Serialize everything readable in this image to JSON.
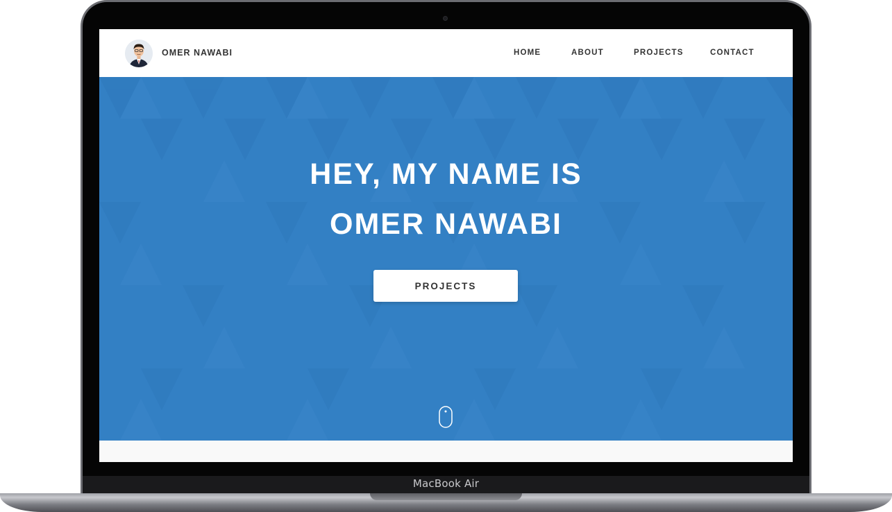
{
  "device": {
    "label": "MacBook Air"
  },
  "navbar": {
    "site_name": "OMER NAWABI",
    "avatar_icon": "avatar-portrait",
    "items": [
      {
        "label": "HOME"
      },
      {
        "label": "ABOUT"
      },
      {
        "label": "PROJECTS"
      },
      {
        "label": "CONTACT"
      }
    ]
  },
  "hero": {
    "title": "HEY, MY NAME IS OMER NAWABI",
    "button_label": "PROJECTS",
    "scroll_icon": "mouse-scroll-icon",
    "background_color": "#3380c4"
  },
  "colors": {
    "accent": "#3380c4",
    "nav_text": "#333333",
    "button_bg": "#ffffff"
  }
}
